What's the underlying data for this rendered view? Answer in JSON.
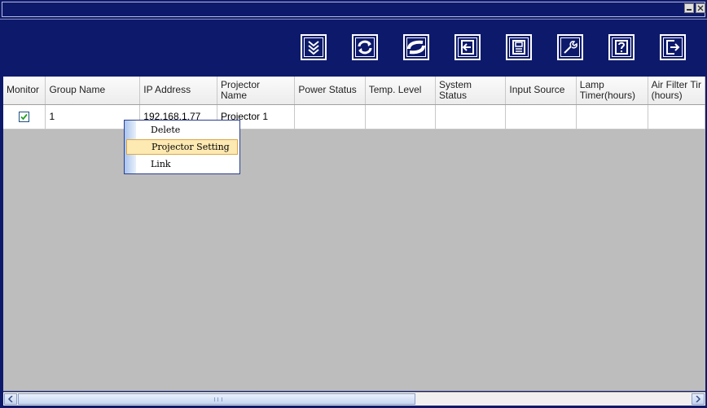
{
  "window": {
    "controls": {
      "minimize_icon": "minimize-icon",
      "close_icon": "close-icon"
    }
  },
  "toolbar": {
    "buttons": [
      {
        "name": "search-projector-button",
        "icon": "chevron-down-double-icon"
      },
      {
        "name": "refresh-button",
        "icon": "refresh-icon"
      },
      {
        "name": "connect-button",
        "icon": "link-loop-icon"
      },
      {
        "name": "import-button",
        "icon": "import-arrow-icon"
      },
      {
        "name": "save-button",
        "icon": "save-disk-icon"
      },
      {
        "name": "settings-button",
        "icon": "wrench-icon"
      },
      {
        "name": "help-button",
        "icon": "question-icon"
      },
      {
        "name": "exit-button",
        "icon": "exit-arrow-icon"
      }
    ]
  },
  "table": {
    "columns": [
      "Monitor",
      "Group Name",
      "IP Address",
      "Projector Name",
      "Power Status",
      "Temp. Level",
      "System Status",
      "Input Source",
      "Lamp Timer(hours)",
      "Air Filter Timer (hours)"
    ],
    "column_display": {
      "projector_name_l1": "Projector",
      "projector_name_l2": "Name",
      "system_status_l1": "System",
      "system_status_l2": "Status",
      "lamp_timer_l1": "Lamp",
      "lamp_timer_l2": "Timer(hours)",
      "air_filter_l1": "Air Filter Tir",
      "air_filter_l2": "(hours)"
    },
    "rows": [
      {
        "monitor_checked": true,
        "group_name": "1",
        "ip_address": "192.168.1.77",
        "projector_name": "Projector 1",
        "power_status": "",
        "temp_level": "",
        "system_status": "",
        "input_source": "",
        "lamp_timer": "",
        "air_filter_timer": ""
      }
    ]
  },
  "context_menu": {
    "items": [
      "Delete",
      "Projector Setting",
      "Link"
    ],
    "highlighted": "Projector Setting"
  },
  "scrollbar": {
    "left_icon": "chevron-left-icon",
    "right_icon": "chevron-right-icon"
  },
  "colors": {
    "frame": "#0d1a6b",
    "grid_background": "#bdbdbd",
    "menu_highlight": "#fde9b2"
  }
}
